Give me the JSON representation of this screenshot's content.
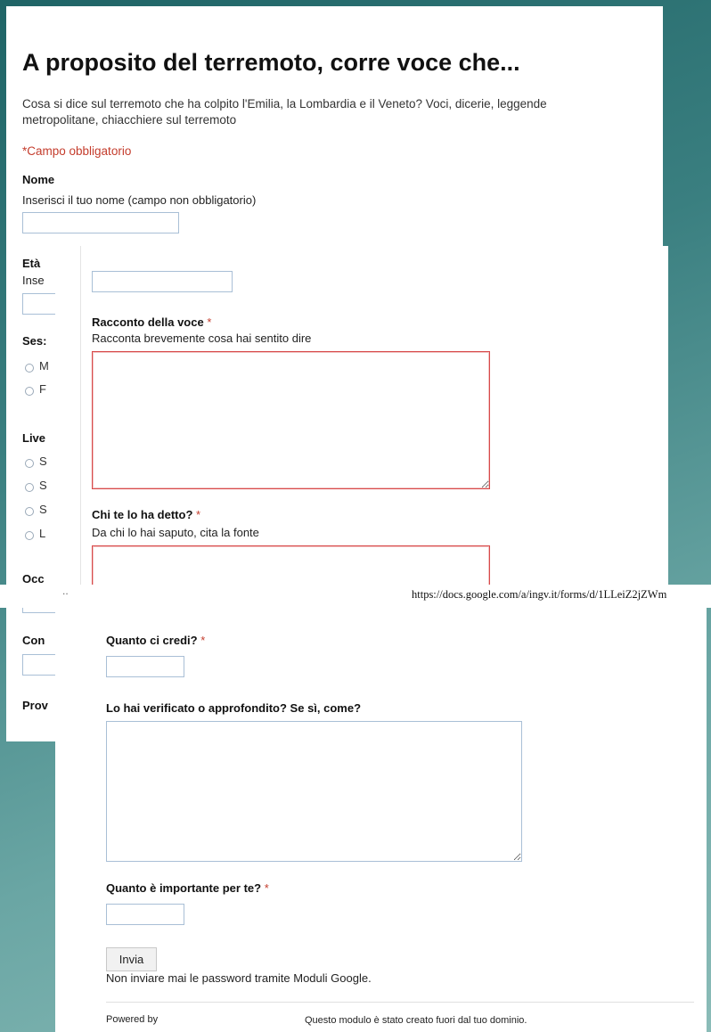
{
  "form": {
    "title": "A proposito del terremoto, corre voce che...",
    "description": "Cosa si dice sul terremoto che ha colpito l'Emilia, la Lombardia e il Veneto? Voci, dicerie, leggende metropolitane, chiacchiere sul terremoto",
    "required_note": "*Campo obbligatorio",
    "required_star": "*"
  },
  "q_nome": {
    "label": "Nome",
    "help": "Inserisci il tuo nome (campo non obbligatorio)",
    "value": ""
  },
  "partial_labels": {
    "eta": "Età",
    "eta_help": "Inse",
    "sesso": "Ses:",
    "sesso_opt1": "M",
    "sesso_opt2": "F",
    "livello": "Live",
    "livello_opt1": "S",
    "livello_opt2": "S",
    "livello_opt3": "S",
    "livello_opt4": "L",
    "occupazione": "Occ",
    "comune": "Con",
    "provincia": "Prov"
  },
  "q_racconto": {
    "label": "Racconto della voce",
    "help": "Racconta brevemente cosa hai sentito dire",
    "value": ""
  },
  "q_fonte": {
    "label": "Chi te lo ha detto?",
    "help": "Da chi lo hai saputo, cita la fonte",
    "value": ""
  },
  "url_bar": {
    "dots": "..",
    "url": "https://docs.google.com/a/ingv.it/forms/d/1LLeiZ2jZWm"
  },
  "q_credi": {
    "label": "Quanto ci credi?",
    "value": ""
  },
  "q_verificato": {
    "label": "Lo hai verificato o approfondito? Se sì, come?",
    "value": ""
  },
  "q_importante": {
    "label": "Quanto è importante per te?",
    "value": ""
  },
  "submit": {
    "label": "Invia"
  },
  "password_warning": "Non inviare mai le password tramite Moduli Google.",
  "footer": {
    "powered_by": "Powered by",
    "domain_note": "Questo modulo è stato creato fuori dal tuo dominio."
  },
  "colors": {
    "required": "#c43c2c",
    "error_border": "#d84a4a",
    "input_border": "#a9bfd6",
    "background": "#3a7f80"
  }
}
